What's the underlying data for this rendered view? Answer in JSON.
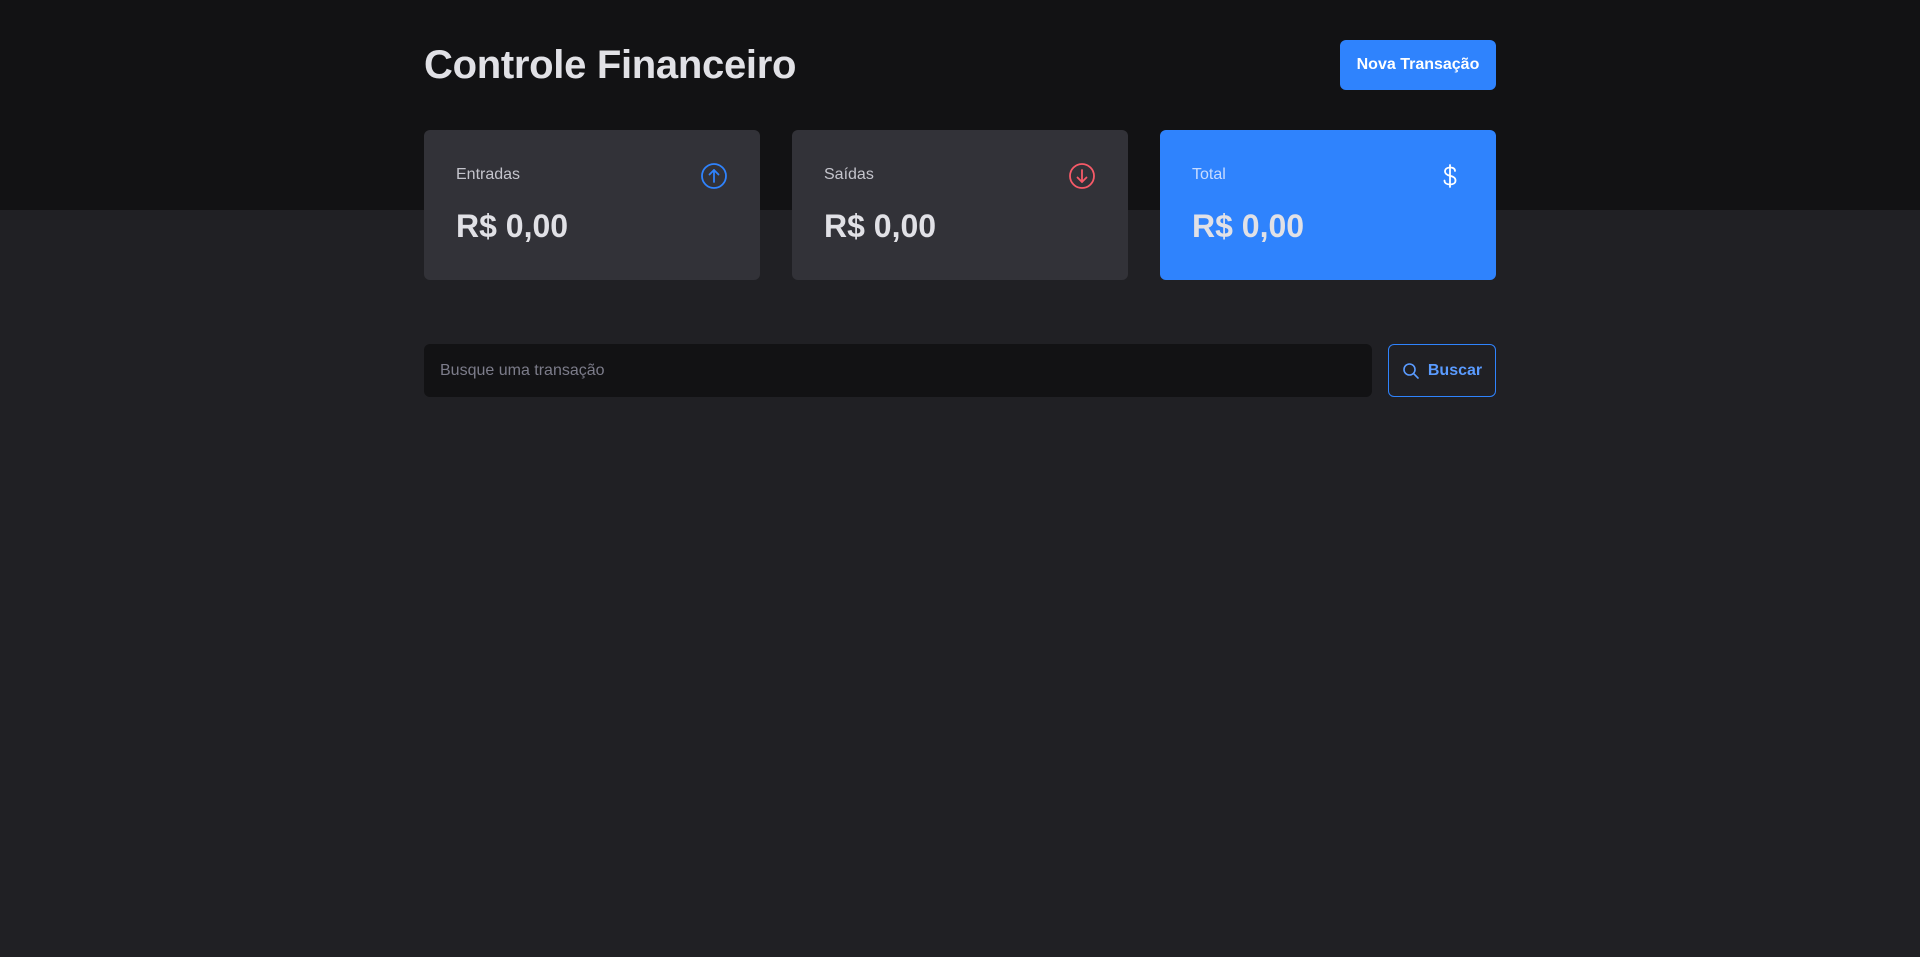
{
  "header": {
    "title": "Controle Financeiro",
    "new_transaction_label": "Nova Transação"
  },
  "summary": {
    "income": {
      "label": "Entradas",
      "value": "R$ 0,00",
      "icon": "arrow-circle-up-icon",
      "icon_color": "#2f83fd"
    },
    "outcome": {
      "label": "Saídas",
      "value": "R$ 0,00",
      "icon": "arrow-circle-down-icon",
      "icon_color": "#f75a68"
    },
    "total": {
      "label": "Total",
      "value": "R$ 0,00",
      "icon": "currency-dollar-icon",
      "icon_color": "#ffffff"
    }
  },
  "search": {
    "placeholder": "Busque uma transação",
    "value": "",
    "button_label": "Buscar",
    "icon": "search-icon"
  },
  "colors": {
    "accent": "#2f83fd",
    "danger": "#f75a68",
    "header_bg": "#121214",
    "page_bg": "#202024",
    "card_bg": "#323238"
  }
}
